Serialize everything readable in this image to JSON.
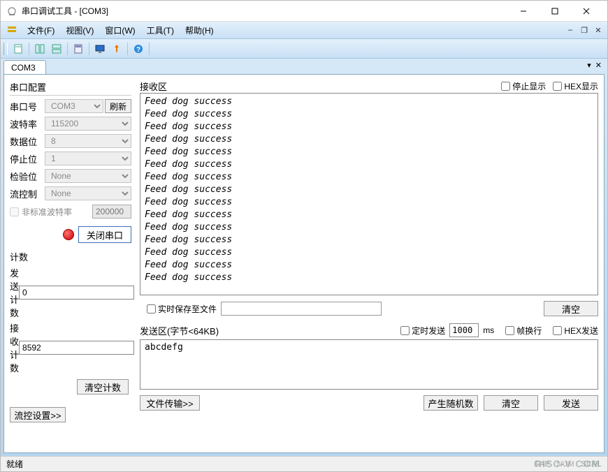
{
  "window": {
    "title": "串口调试工具 - [COM3]"
  },
  "menu": {
    "file": "文件(F)",
    "view": "视图(V)",
    "window": "窗口(W)",
    "tools": "工具(T)",
    "help": "帮助(H)"
  },
  "tab": {
    "name": "COM3"
  },
  "config": {
    "group_title": "串口配置",
    "port_label": "串口号",
    "port_value": "COM3",
    "refresh_btn": "刷新",
    "baud_label": "波特率",
    "baud_value": "115200",
    "data_label": "数据位",
    "data_value": "8",
    "stop_label": "停止位",
    "stop_value": "1",
    "parity_label": "检验位",
    "parity_value": "None",
    "flow_label": "流控制",
    "flow_value": "None",
    "nonstd_label": "非标准波特率",
    "nonstd_value": "200000",
    "close_port_btn": "关闭串口"
  },
  "counters": {
    "group_title": "计数",
    "send_label": "发送计数",
    "send_value": "0",
    "recv_label": "接收计数",
    "recv_value": "8592",
    "clear_btn": "清空计数"
  },
  "flow_settings_btn": "流控设置>>",
  "rx": {
    "label": "接收区",
    "stop_display": "停止显示",
    "hex_display": "HEX显示",
    "content": "Feed dog success\nFeed dog success\nFeed dog success\nFeed dog success\nFeed dog success\nFeed dog success\nFeed dog success\nFeed dog success\nFeed dog success\nFeed dog success\nFeed dog success\nFeed dog success\nFeed dog success\nFeed dog success\nFeed dog success",
    "save_to_file": "实时保存至文件",
    "clear_btn": "清空"
  },
  "tx": {
    "label": "发送区(字节<64KB)",
    "timed_send": "定时发送",
    "interval": "1000",
    "interval_unit": "ms",
    "frame_wrap": "帧换行",
    "hex_send": "HEX发送",
    "content": "abcdefg",
    "file_transfer_btn": "文件传输>>",
    "random_btn": "产生随机数",
    "clear_btn": "清空",
    "send_btn": "发送"
  },
  "statusbar": {
    "ready": "就绪",
    "cap": "CAP",
    "num": "NUM",
    "scrl": "SCRL"
  },
  "watermark": "RISC-V  COM"
}
